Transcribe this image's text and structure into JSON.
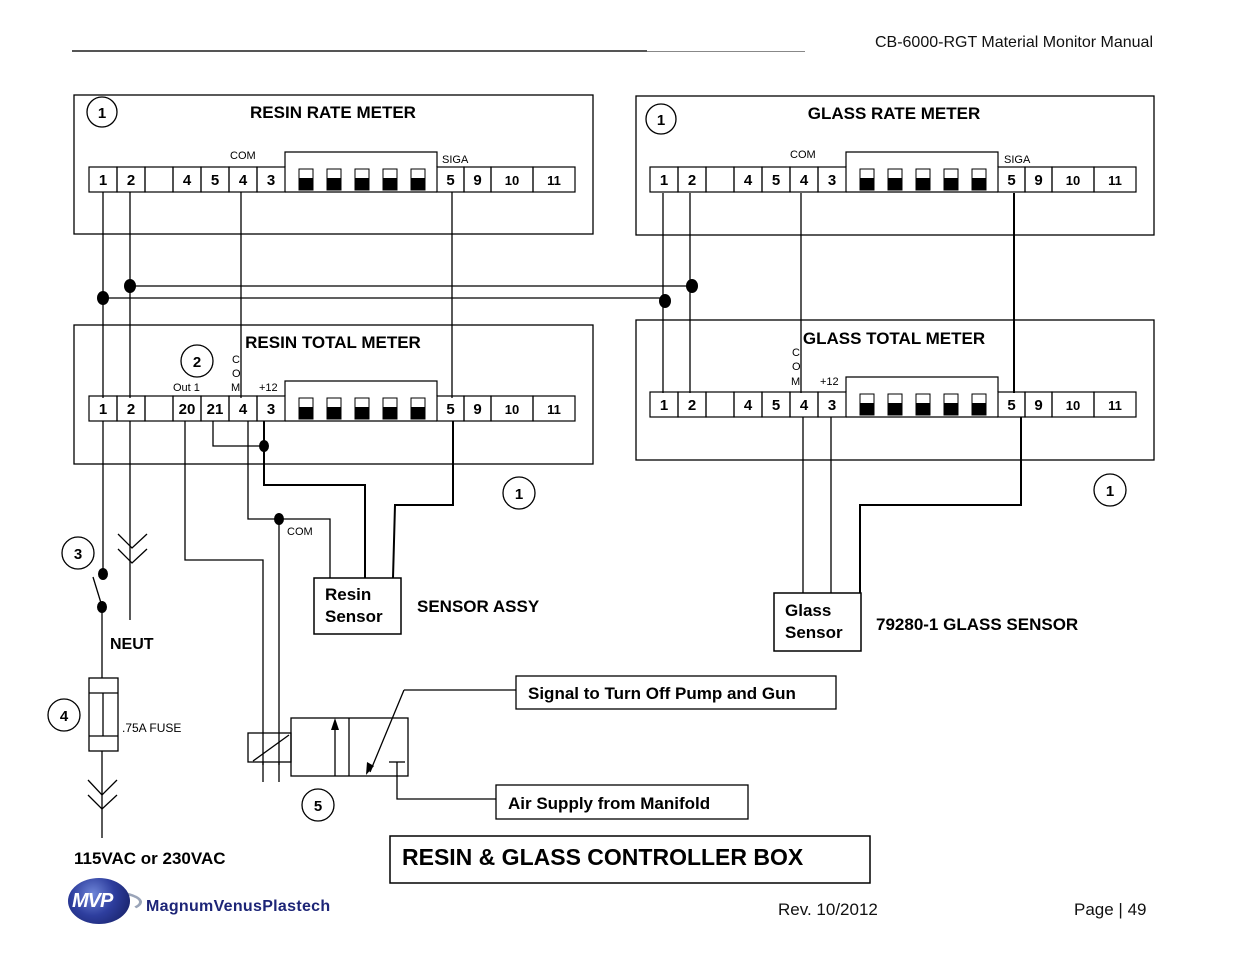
{
  "header": {
    "manual_title": "CB-6000-RGT Material Monitor Manual"
  },
  "footer": {
    "revision": "Rev. 10/2012",
    "page": "Page | 49",
    "logo_mark": "MVP",
    "logo_text": "MagnumVenusPlastech"
  },
  "diagram": {
    "title": "RESIN & GLASS CONTROLLER BOX",
    "meters": {
      "resin_rate": {
        "title": "RESIN RATE METER",
        "callout": "1",
        "labels": {
          "com": "COM",
          "siga": "SIGA"
        }
      },
      "glass_rate": {
        "title": "GLASS RATE METER",
        "callout": "1",
        "labels": {
          "com": "COM",
          "siga": "SIGA"
        }
      },
      "resin_total": {
        "title": "RESIN TOTAL METER",
        "callout": "2",
        "labels": {
          "out1": "Out 1",
          "com_c": "C",
          "com_o": "O",
          "com_m": "M",
          "plus12": "+12"
        }
      },
      "glass_total": {
        "title": "GLASS TOTAL METER",
        "labels": {
          "com_c": "C",
          "com_o": "O",
          "com_m": "M",
          "plus12": "+12"
        }
      }
    },
    "terminals": {
      "rate": [
        "1",
        "2",
        "",
        "4",
        "5",
        "4",
        "3"
      ],
      "rate_right": [
        "5",
        "9",
        "10",
        "11"
      ],
      "resin_total": [
        "1",
        "2",
        "",
        "20",
        "21",
        "4",
        "3"
      ],
      "glass_total": [
        "1",
        "2",
        "",
        "4",
        "5",
        "4",
        "3"
      ],
      "total_right": [
        "5",
        "9",
        "10",
        "11"
      ]
    },
    "sensor_callouts": {
      "resin": "1",
      "glass": "1"
    },
    "resin_sensor": {
      "line1": "Resin",
      "line2": "Sensor",
      "caption": "SENSOR ASSY",
      "com_label": "COM"
    },
    "glass_sensor": {
      "line1": "Glass",
      "line2": "Sensor",
      "caption": "79280-1 GLASS SENSOR"
    },
    "power": {
      "switch_callout": "3",
      "neutral_label": "NEUT",
      "fuse_callout": "4",
      "fuse_label": ".75A FUSE",
      "supply_label": "115VAC or 230VAC"
    },
    "valve": {
      "callout": "5",
      "signal_label": "Signal to Turn Off Pump and Gun",
      "air_label": "Air Supply from Manifold"
    }
  }
}
